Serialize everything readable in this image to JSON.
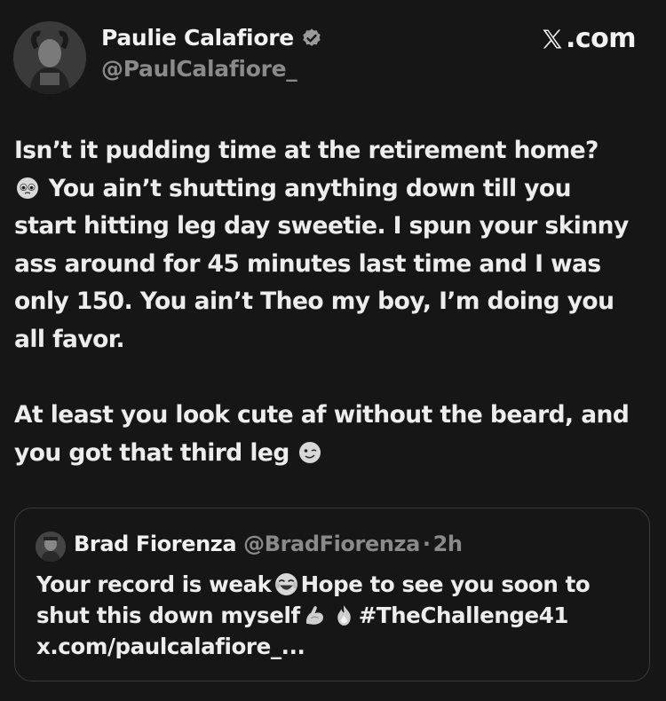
{
  "author": {
    "name": "Paulie Calafiore",
    "handle": "@PaulCalafiore_",
    "verified_icon": "verified-badge-icon"
  },
  "site_label": ".com",
  "tweet": {
    "lines": [
      "Isn’t it pudding time at the retirement home?",
      "You ain’t shutting anything down till you",
      "start hitting leg day sweetie. I spun your skinny",
      "ass around for 45 minutes last time and I was",
      "only 150. You ain’t Theo my boy, I’m doing you",
      "all favor.",
      "At least you look cute af without the beard, and",
      "you got that third leg"
    ],
    "emojis": [
      "pleading-face-icon",
      "winking-face-icon"
    ]
  },
  "quoted_tweet": {
    "name": "Brad Fiorenza",
    "handle": "@BradFiorenza",
    "separator": "·",
    "time": "2h",
    "line1_a": "Your record is weak",
    "line1_b": "Hope to see you soon to",
    "line2_a": "shut this down myself",
    "line2_b": "#TheChallenge41",
    "link": "x.com/paulcalafiore_...",
    "emojis": [
      "laughing-tears-icon",
      "flexed-biceps-icon",
      "fire-icon"
    ]
  }
}
